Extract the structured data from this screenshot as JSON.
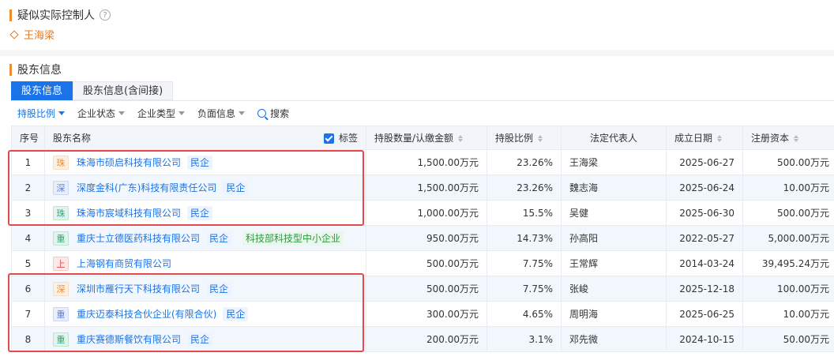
{
  "controller_section": {
    "title": "疑似实际控制人",
    "help_icon": "?",
    "name": "王海梁"
  },
  "shareholder_section": {
    "title": "股东信息"
  },
  "tabs": [
    {
      "label": "股东信息",
      "active": true
    },
    {
      "label": "股东信息(含间接)",
      "active": false
    }
  ],
  "filters": [
    {
      "label": "持股比例",
      "active": true
    },
    {
      "label": "企业状态",
      "active": false
    },
    {
      "label": "企业类型",
      "active": false
    },
    {
      "label": "负面信息",
      "active": false
    }
  ],
  "search_label": "搜索",
  "table": {
    "headers": {
      "index": "序号",
      "name": "股东名称",
      "tag_toggle": "标签",
      "amount": "持股数量/认缴金额",
      "ratio": "持股比例",
      "legal_rep": "法定代表人",
      "founded": "成立日期",
      "capital": "注册资本"
    },
    "rows": [
      {
        "index": "1",
        "logo": "珠",
        "logo_color": "#f08c2c",
        "logo_bg": "#fdf0e3",
        "name": "珠海市硕启科技有限公司",
        "tags": [
          "民企"
        ],
        "amount": "1,500.00万元",
        "ratio": "23.26%",
        "legal_rep": "王海梁",
        "founded": "2025-06-27",
        "capital": "500.00万元"
      },
      {
        "index": "2",
        "logo": "深",
        "logo_color": "#5b7fd6",
        "logo_bg": "#e8eefb",
        "name": "深度金科(广东)科技有限责任公司",
        "tags": [
          "民企"
        ],
        "amount": "1,500.00万元",
        "ratio": "23.26%",
        "legal_rep": "魏志海",
        "founded": "2025-06-24",
        "capital": "10.00万元"
      },
      {
        "index": "3",
        "logo": "珠",
        "logo_color": "#2fa37a",
        "logo_bg": "#e3f4ec",
        "name": "珠海市宸域科技有限公司",
        "tags": [
          "民企"
        ],
        "amount": "1,000.00万元",
        "ratio": "15.5%",
        "legal_rep": "吴健",
        "founded": "2025-06-30",
        "capital": "500.00万元"
      },
      {
        "index": "4",
        "logo": "重",
        "logo_color": "#2fa37a",
        "logo_bg": "#e3f4ec",
        "name": "重庆士立德医药科技有限公司",
        "tags": [
          "民企"
        ],
        "green_tag": "科技部科技型中小企业",
        "amount": "950.00万元",
        "ratio": "14.73%",
        "legal_rep": "孙高阳",
        "founded": "2022-05-27",
        "capital": "5,000.00万元"
      },
      {
        "index": "5",
        "logo": "上",
        "logo_color": "#e5484d",
        "logo_bg": "#fde8e8",
        "name": "上海钢有商贸有限公司",
        "tags": [],
        "amount": "500.00万元",
        "ratio": "7.75%",
        "legal_rep": "王常辉",
        "founded": "2014-03-24",
        "capital": "39,495.24万元"
      },
      {
        "index": "6",
        "logo": "深",
        "logo_color": "#f08c2c",
        "logo_bg": "#fdf0e3",
        "name": "深圳市雁行天下科技有限公司",
        "tags": [
          "民企"
        ],
        "amount": "500.00万元",
        "ratio": "7.75%",
        "legal_rep": "张峻",
        "founded": "2025-12-18",
        "capital": "100.00万元"
      },
      {
        "index": "7",
        "logo": "重",
        "logo_color": "#5b7fd6",
        "logo_bg": "#e8eefb",
        "name": "重庆迈泰科技合伙企业(有限合伙)",
        "tags": [
          "民企"
        ],
        "amount": "300.00万元",
        "ratio": "4.65%",
        "legal_rep": "周明海",
        "founded": "2025-06-25",
        "capital": "10.00万元"
      },
      {
        "index": "8",
        "logo": "重",
        "logo_color": "#2fa37a",
        "logo_bg": "#e3f4ec",
        "name": "重庆赛德斯餐饮有限公司",
        "tags": [
          "民企"
        ],
        "amount": "200.00万元",
        "ratio": "3.1%",
        "legal_rep": "邓先微",
        "founded": "2024-10-15",
        "capital": "50.00万元"
      }
    ]
  },
  "colors": {
    "accent": "#1a73e8",
    "orange": "#f08c2c",
    "highlight_red": "#e5484d"
  }
}
